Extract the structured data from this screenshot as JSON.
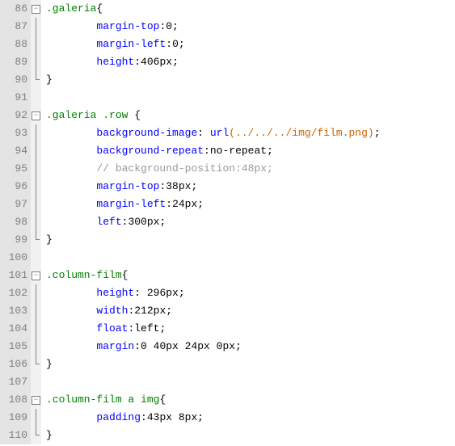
{
  "lines": [
    {
      "n": 86,
      "fold": "open",
      "indent": 0,
      "tokens": [
        [
          ".galeria",
          "sel"
        ],
        [
          "{",
          "punct"
        ]
      ]
    },
    {
      "n": 87,
      "fold": "line",
      "indent": 2,
      "tokens": [
        [
          "margin-top",
          "prop"
        ],
        [
          ":",
          "punct"
        ],
        [
          "0",
          "num"
        ],
        [
          ";",
          "punct"
        ]
      ]
    },
    {
      "n": 88,
      "fold": "line",
      "indent": 2,
      "tokens": [
        [
          "margin-left",
          "prop"
        ],
        [
          ":",
          "punct"
        ],
        [
          "0",
          "num"
        ],
        [
          ";",
          "punct"
        ]
      ]
    },
    {
      "n": 89,
      "fold": "line",
      "indent": 2,
      "tokens": [
        [
          "height",
          "prop"
        ],
        [
          ":",
          "punct"
        ],
        [
          "406px",
          "num"
        ],
        [
          ";",
          "punct"
        ]
      ]
    },
    {
      "n": 90,
      "fold": "corner",
      "indent": 0,
      "tokens": [
        [
          "}",
          "punct"
        ]
      ]
    },
    {
      "n": 91,
      "fold": "none",
      "indent": 0,
      "tokens": []
    },
    {
      "n": 92,
      "fold": "open",
      "indent": 0,
      "tokens": [
        [
          ".galeria .row ",
          "sel"
        ],
        [
          "{",
          "punct"
        ]
      ]
    },
    {
      "n": 93,
      "fold": "line",
      "indent": 2,
      "tokens": [
        [
          "background-image",
          "prop"
        ],
        [
          ": ",
          "punct"
        ],
        [
          "url",
          "func"
        ],
        [
          "(",
          "urlv"
        ],
        [
          "../../../img/film.png",
          "urlv"
        ],
        [
          ")",
          "urlv"
        ],
        [
          ";",
          "punct"
        ]
      ]
    },
    {
      "n": 94,
      "fold": "line",
      "indent": 2,
      "tokens": [
        [
          "background-repeat",
          "prop"
        ],
        [
          ":",
          "punct"
        ],
        [
          "no-repeat",
          "num"
        ],
        [
          ";",
          "punct"
        ]
      ]
    },
    {
      "n": 95,
      "fold": "line",
      "indent": 2,
      "tokens": [
        [
          "// background-position:48px;",
          "cmt"
        ]
      ]
    },
    {
      "n": 96,
      "fold": "line",
      "indent": 2,
      "tokens": [
        [
          "margin-top",
          "prop"
        ],
        [
          ":",
          "punct"
        ],
        [
          "38px",
          "num"
        ],
        [
          ";",
          "punct"
        ]
      ]
    },
    {
      "n": 97,
      "fold": "line",
      "indent": 2,
      "tokens": [
        [
          "margin-left",
          "prop"
        ],
        [
          ":",
          "punct"
        ],
        [
          "24px",
          "num"
        ],
        [
          ";",
          "punct"
        ]
      ]
    },
    {
      "n": 98,
      "fold": "line",
      "indent": 2,
      "tokens": [
        [
          "left",
          "prop"
        ],
        [
          ":",
          "punct"
        ],
        [
          "300px",
          "num"
        ],
        [
          ";",
          "punct"
        ]
      ]
    },
    {
      "n": 99,
      "fold": "corner",
      "indent": 0,
      "tokens": [
        [
          "}",
          "punct"
        ]
      ]
    },
    {
      "n": 100,
      "fold": "none",
      "indent": 0,
      "tokens": []
    },
    {
      "n": 101,
      "fold": "open",
      "indent": 0,
      "tokens": [
        [
          ".column-film",
          "sel"
        ],
        [
          "{",
          "punct"
        ]
      ]
    },
    {
      "n": 102,
      "fold": "line",
      "indent": 2,
      "tokens": [
        [
          "height",
          "prop"
        ],
        [
          ": ",
          "punct"
        ],
        [
          "296px",
          "num"
        ],
        [
          ";",
          "punct"
        ]
      ]
    },
    {
      "n": 103,
      "fold": "line",
      "indent": 2,
      "tokens": [
        [
          "width",
          "prop"
        ],
        [
          ":",
          "punct"
        ],
        [
          "212px",
          "num"
        ],
        [
          ";",
          "punct"
        ]
      ]
    },
    {
      "n": 104,
      "fold": "line",
      "indent": 2,
      "tokens": [
        [
          "float",
          "prop"
        ],
        [
          ":",
          "punct"
        ],
        [
          "left",
          "num"
        ],
        [
          ";",
          "punct"
        ]
      ]
    },
    {
      "n": 105,
      "fold": "line",
      "indent": 2,
      "tokens": [
        [
          "margin",
          "prop"
        ],
        [
          ":",
          "punct"
        ],
        [
          "0 40px 24px 0px",
          "num"
        ],
        [
          ";",
          "punct"
        ]
      ]
    },
    {
      "n": 106,
      "fold": "corner",
      "indent": 0,
      "tokens": [
        [
          "}",
          "punct"
        ]
      ]
    },
    {
      "n": 107,
      "fold": "none",
      "indent": 0,
      "tokens": []
    },
    {
      "n": 108,
      "fold": "open",
      "indent": 0,
      "tokens": [
        [
          ".column-film a img",
          "sel"
        ],
        [
          "{",
          "punct"
        ]
      ]
    },
    {
      "n": 109,
      "fold": "line",
      "indent": 2,
      "tokens": [
        [
          "padding",
          "prop"
        ],
        [
          ":",
          "punct"
        ],
        [
          "43px 8px",
          "num"
        ],
        [
          ";",
          "punct"
        ]
      ]
    },
    {
      "n": 110,
      "fold": "corner",
      "indent": 0,
      "tokens": [
        [
          "}",
          "punct"
        ]
      ]
    }
  ]
}
